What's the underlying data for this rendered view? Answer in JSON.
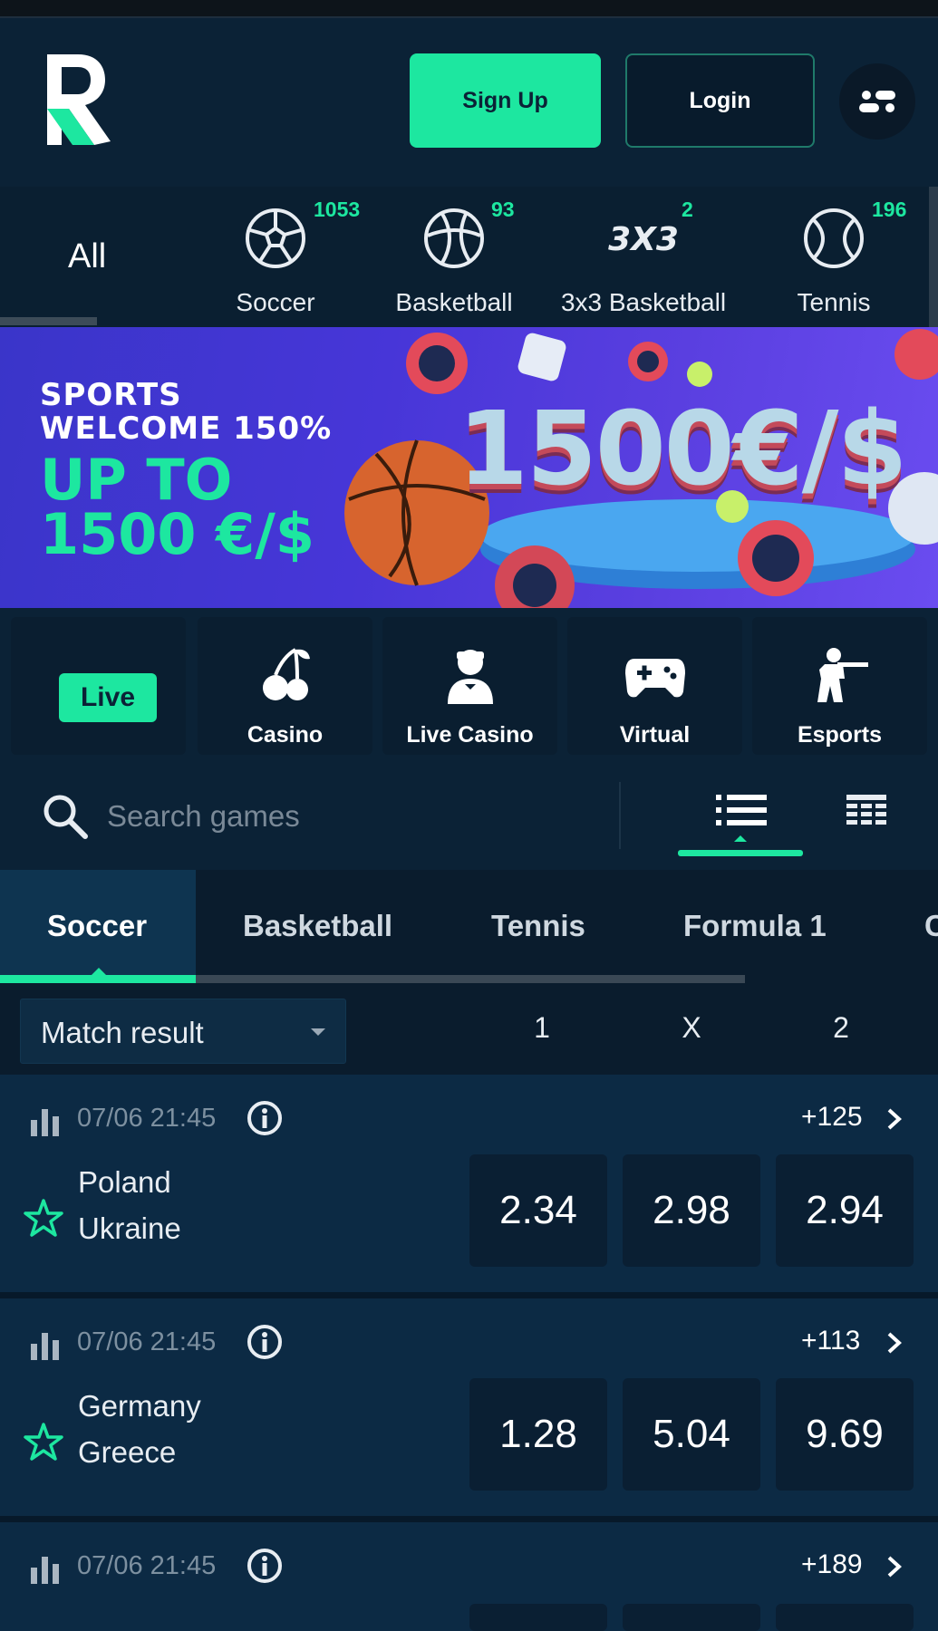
{
  "header": {
    "signup_label": "Sign Up",
    "login_label": "Login"
  },
  "sports_nav": {
    "all_label": "All",
    "items": [
      {
        "label": "Soccer",
        "count": "1053",
        "icon": "soccer-ball-icon"
      },
      {
        "label": "Basketball",
        "count": "93",
        "icon": "basketball-icon"
      },
      {
        "label": "3x3 Basketball",
        "count": "2",
        "icon": "3x3-basketball-icon"
      },
      {
        "label": "Tennis",
        "count": "196",
        "icon": "tennis-ball-icon"
      }
    ]
  },
  "banner": {
    "line1": "SPORTS",
    "line2": "WELCOME 150%",
    "line3": "UP TO",
    "line4": "1500 €/$",
    "amount": "1500€/$"
  },
  "categories": {
    "live": "Live",
    "casino": "Casino",
    "live_casino": "Live Casino",
    "virtual": "Virtual",
    "esports": "Esports"
  },
  "search": {
    "placeholder": "Search games"
  },
  "sport_tabs": [
    "Soccer",
    "Basketball",
    "Tennis",
    "Formula 1",
    "C"
  ],
  "market": {
    "selected": "Match result",
    "col1": "1",
    "colx": "X",
    "col2": "2"
  },
  "matches": [
    {
      "time": "07/06 21:45",
      "more": "+125",
      "team1": "Poland",
      "team2": "Ukraine",
      "odds": [
        "2.34",
        "2.98",
        "2.94"
      ]
    },
    {
      "time": "07/06 21:45",
      "more": "+113",
      "team1": "Germany",
      "team2": "Greece",
      "odds": [
        "1.28",
        "5.04",
        "9.69"
      ]
    },
    {
      "time": "07/06 21:45",
      "more": "+189"
    }
  ],
  "colors": {
    "accent": "#1de7a0",
    "background": "#0b2236",
    "card": "#0c2a44"
  }
}
